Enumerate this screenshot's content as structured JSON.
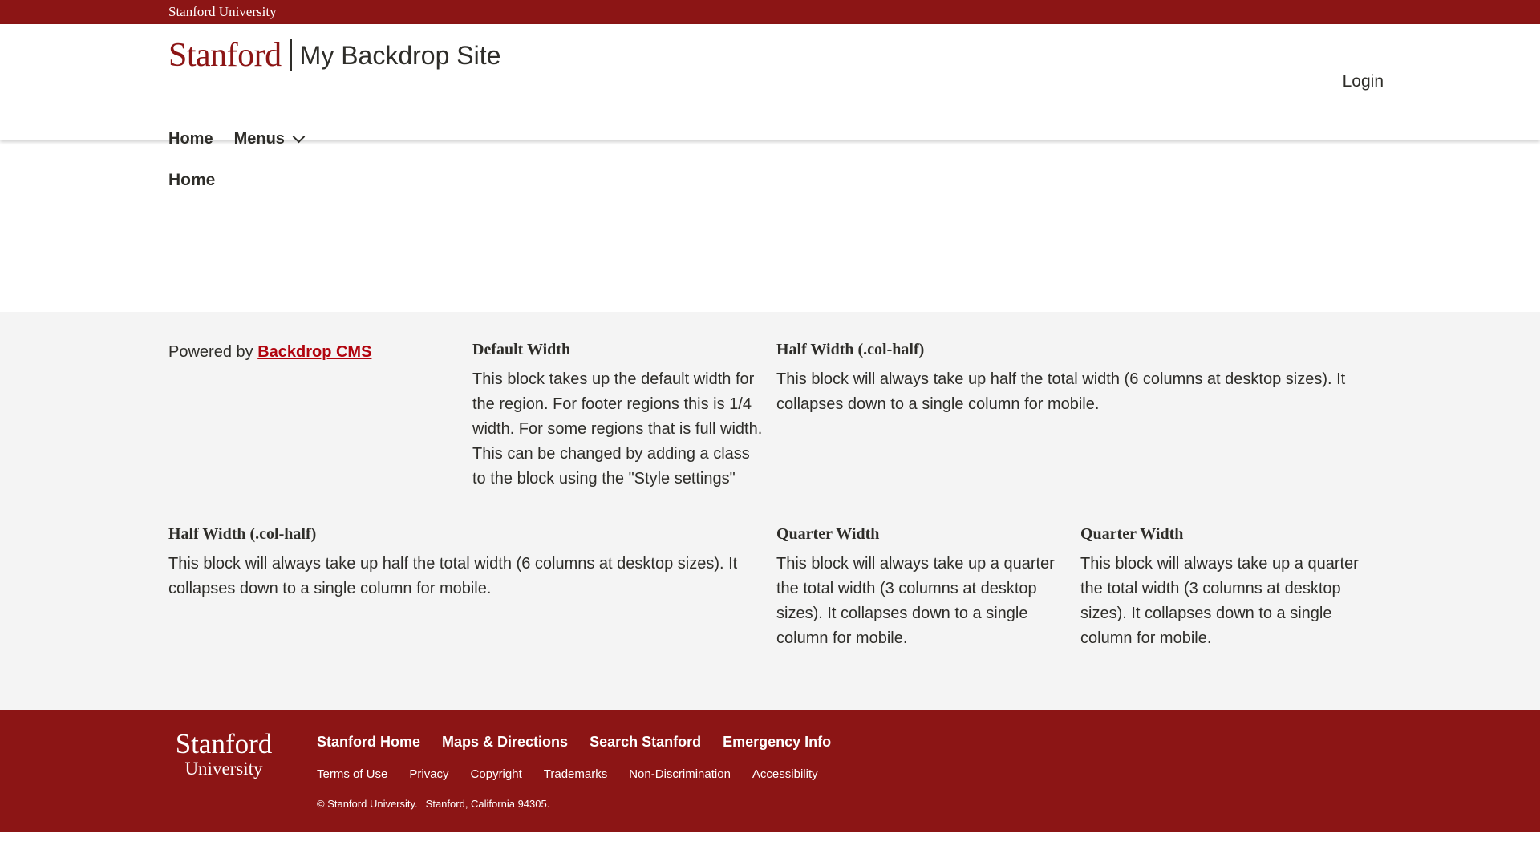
{
  "brand_bar": {
    "label": "Stanford University"
  },
  "header": {
    "logo_text": "Stanford",
    "site_name": "My Backdrop Site",
    "login_label": "Login",
    "nav": [
      {
        "label": "Home"
      },
      {
        "label": "Menus",
        "has_dropdown": true
      }
    ]
  },
  "main": {
    "title": "Home"
  },
  "footer_regions": {
    "powered": {
      "prefix": "Powered by",
      "link_label": "Backdrop CMS",
      "link_color": "#b1040e"
    },
    "blocks": [
      {
        "title": "Default Width",
        "body": "This block takes up the default width for the region. For footer regions this is 1/4 width. For some regions that is full width. This can be changed by adding a class to the block using the \"Style settings\""
      },
      {
        "title": "Half Width (.col-half)",
        "body": "This block will always take up half the total width (6 columns at desktop sizes). It collapses down to a single column for mobile."
      },
      {
        "title": "Half Width (.col-half)",
        "body": "This block will always take up half the total width (6 columns at desktop sizes). It collapses down to a single column for mobile."
      },
      {
        "title": "Quarter Width",
        "body": "This block will always take up a quarter the total width (3 columns at desktop sizes). It collapses down to a single column for mobile."
      },
      {
        "title": "Quarter Width",
        "body": "This block will always take up a quarter the total width (3 columns at desktop sizes). It collapses down to a single column for mobile."
      }
    ]
  },
  "global_footer": {
    "logo_line1": "Stanford",
    "logo_line2": "University",
    "primary_links": [
      {
        "label": "Stanford Home"
      },
      {
        "label": "Maps & Directions"
      },
      {
        "label": "Search Stanford"
      },
      {
        "label": "Emergency Info"
      }
    ],
    "secondary_links": [
      {
        "label": "Terms of Use"
      },
      {
        "label": "Privacy"
      },
      {
        "label": "Copyright"
      },
      {
        "label": "Trademarks"
      },
      {
        "label": "Non-Discrimination"
      },
      {
        "label": "Accessibility"
      }
    ],
    "copyright": "© Stanford University.",
    "address": "Stanford, California 94305."
  },
  "colors": {
    "cardinal_red": "#8c1515",
    "link_red": "#b1040e",
    "text": "#2e2d29",
    "region_bg": "#f4f4f4"
  }
}
